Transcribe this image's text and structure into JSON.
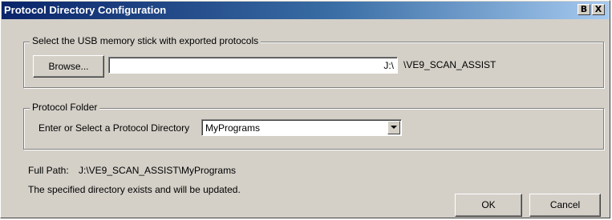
{
  "window": {
    "title": "Protocol Directory Configuration",
    "help_button": "B",
    "close_button": "X"
  },
  "usb_group": {
    "legend": "Select the USB memory stick with exported protocols",
    "browse_label": "Browse...",
    "path_value": "",
    "drive": "J:\\",
    "folder": "\\VE9_SCAN_ASSIST"
  },
  "protocol_group": {
    "legend": "Protocol Folder",
    "select_label": "Enter or Select a Protocol Directory",
    "selected_directory": "MyPrograms"
  },
  "status": {
    "full_path_label": "Full Path:",
    "full_path_value": "J:\\VE9_SCAN_ASSIST\\MyPrograms",
    "message": "The specified directory exists and will be updated."
  },
  "buttons": {
    "ok": "OK",
    "cancel": "Cancel"
  },
  "colors": {
    "title_gradient_start": "#0a246a",
    "title_gradient_end": "#a6caf0",
    "dialog_face": "#d4d0c8"
  },
  "icons": {
    "help": "help-icon",
    "close": "close-icon",
    "dropdown": "chevron-down-icon"
  }
}
